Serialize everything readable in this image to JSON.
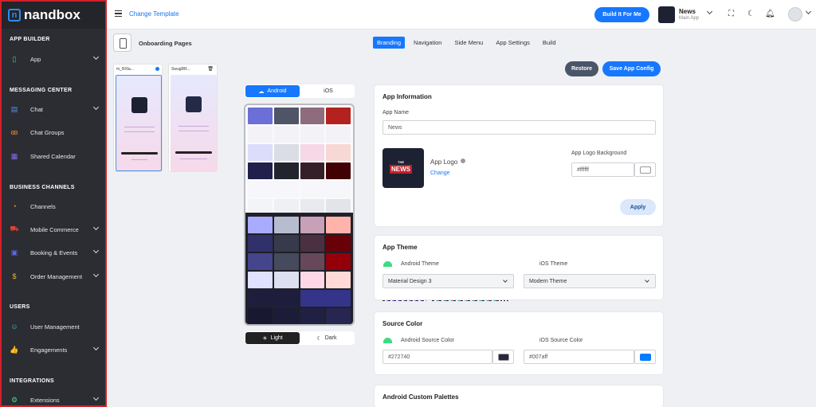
{
  "sidebar": {
    "logo": "nandbox",
    "sections": {
      "app_builder": "APP BUILDER",
      "messaging": "MESSAGING CENTER",
      "business": "BUSINESS CHANNELS",
      "users": "USERS",
      "integrations": "INTEGRATIONS"
    },
    "items": {
      "app": "App",
      "chat": "Chat",
      "chat_groups": "Chat Groups",
      "shared_calendar": "Shared Calendar",
      "channels": "Channels",
      "mobile_commerce": "Mobile Commerce",
      "booking": "Booking & Events",
      "order_management": "Order Management",
      "user_management": "User Management",
      "engagements": "Engagements",
      "extensions": "Extensions"
    }
  },
  "topbar": {
    "change_template": "Change Template",
    "build_button": "Build It For Me",
    "app_name": "News",
    "app_sub": "Main App"
  },
  "onboarding": {
    "title": "Onboarding Pages",
    "page1": "m_RXla...",
    "page2": "SwugRR..."
  },
  "tabs": {
    "branding": "Branding",
    "navigation": "Navigation",
    "side_menu": "Side Menu",
    "app_settings": "App Settings",
    "build": "Build"
  },
  "platform": {
    "android": "Android",
    "ios": "iOS"
  },
  "mode": {
    "light": "Light",
    "dark": "Dark"
  },
  "actions": {
    "restore": "Restore",
    "save": "Save App Config"
  },
  "app_info": {
    "title": "App Information",
    "name_label": "App Name",
    "name_value": "News",
    "logo_label": "App Logo",
    "change": "Change",
    "bg_label": "App Logo Background",
    "bg_value": "#ffffff",
    "apply": "Apply",
    "logo_word": "NEWS",
    "logo_the": "THE"
  },
  "theme": {
    "title": "App Theme",
    "android_label": "Android Theme",
    "android_value": "Material Design 3",
    "ios_label": "iOS Theme",
    "ios_value": "Modern Theme"
  },
  "source": {
    "title": "Source Color",
    "android_label": "Android Source Color",
    "android_value": "#272740",
    "ios_label": "iOS Source Color",
    "ios_value": "#007aff"
  },
  "custom": {
    "title": "Android Custom Palettes"
  },
  "colors": {
    "accent": "#1677ff",
    "restore": "#4a5568",
    "sidebar": "#2b2d33"
  }
}
